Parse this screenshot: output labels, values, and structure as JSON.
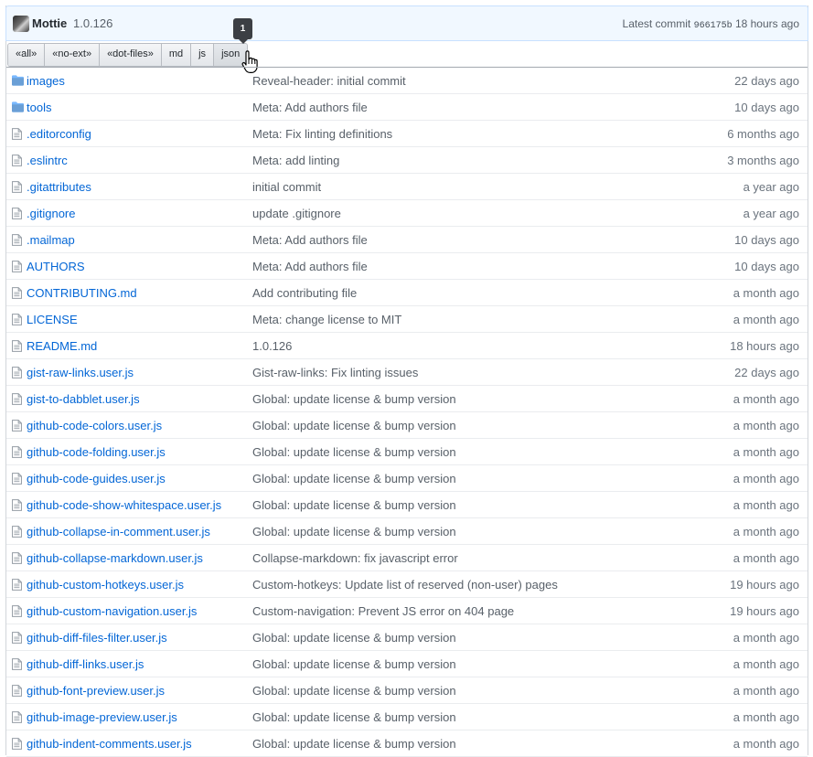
{
  "commit": {
    "author": "Mottie",
    "version": "1.0.126",
    "latest_label": "Latest commit",
    "sha": "966175b",
    "age": "18 hours ago"
  },
  "filters": [
    {
      "label": "«all»"
    },
    {
      "label": "«no-ext»"
    },
    {
      "label": "«dot-files»"
    },
    {
      "label": "md"
    },
    {
      "label": "js"
    },
    {
      "label": "json"
    }
  ],
  "tooltip": {
    "count": "1"
  },
  "files": [
    {
      "type": "folder",
      "name": "images",
      "message": "Reveal-header: initial commit",
      "age": "22 days ago"
    },
    {
      "type": "folder",
      "name": "tools",
      "message": "Meta: Add authors file",
      "age": "10 days ago"
    },
    {
      "type": "file",
      "name": ".editorconfig",
      "message": "Meta: Fix linting definitions",
      "age": "6 months ago"
    },
    {
      "type": "file",
      "name": ".eslintrc",
      "message": "Meta: add linting",
      "age": "3 months ago"
    },
    {
      "type": "file",
      "name": ".gitattributes",
      "message": "initial commit",
      "age": "a year ago"
    },
    {
      "type": "file",
      "name": ".gitignore",
      "message": "update .gitignore",
      "age": "a year ago"
    },
    {
      "type": "file",
      "name": ".mailmap",
      "message": "Meta: Add authors file",
      "age": "10 days ago"
    },
    {
      "type": "file",
      "name": "AUTHORS",
      "message": "Meta: Add authors file",
      "age": "10 days ago"
    },
    {
      "type": "file",
      "name": "CONTRIBUTING.md",
      "message": "Add contributing file",
      "age": "a month ago"
    },
    {
      "type": "file",
      "name": "LICENSE",
      "message": "Meta: change license to MIT",
      "age": "a month ago"
    },
    {
      "type": "file",
      "name": "README.md",
      "message": "1.0.126",
      "age": "18 hours ago"
    },
    {
      "type": "file",
      "name": "gist-raw-links.user.js",
      "message": "Gist-raw-links: Fix linting issues",
      "age": "22 days ago"
    },
    {
      "type": "file",
      "name": "gist-to-dabblet.user.js",
      "message": "Global: update license & bump version",
      "age": "a month ago"
    },
    {
      "type": "file",
      "name": "github-code-colors.user.js",
      "message": "Global: update license & bump version",
      "age": "a month ago"
    },
    {
      "type": "file",
      "name": "github-code-folding.user.js",
      "message": "Global: update license & bump version",
      "age": "a month ago"
    },
    {
      "type": "file",
      "name": "github-code-guides.user.js",
      "message": "Global: update license & bump version",
      "age": "a month ago"
    },
    {
      "type": "file",
      "name": "github-code-show-whitespace.user.js",
      "message": "Global: update license & bump version",
      "age": "a month ago"
    },
    {
      "type": "file",
      "name": "github-collapse-in-comment.user.js",
      "message": "Global: update license & bump version",
      "age": "a month ago"
    },
    {
      "type": "file",
      "name": "github-collapse-markdown.user.js",
      "message": "Collapse-markdown: fix javascript error",
      "age": "a month ago"
    },
    {
      "type": "file",
      "name": "github-custom-hotkeys.user.js",
      "message": "Custom-hotkeys: Update list of reserved (non-user) pages",
      "age": "19 hours ago"
    },
    {
      "type": "file",
      "name": "github-custom-navigation.user.js",
      "message": "Custom-navigation: Prevent JS error on 404 page",
      "age": "19 hours ago"
    },
    {
      "type": "file",
      "name": "github-diff-files-filter.user.js",
      "message": "Global: update license & bump version",
      "age": "a month ago"
    },
    {
      "type": "file",
      "name": "github-diff-links.user.js",
      "message": "Global: update license & bump version",
      "age": "a month ago"
    },
    {
      "type": "file",
      "name": "github-font-preview.user.js",
      "message": "Global: update license & bump version",
      "age": "a month ago"
    },
    {
      "type": "file",
      "name": "github-image-preview.user.js",
      "message": "Global: update license & bump version",
      "age": "a month ago"
    },
    {
      "type": "file",
      "name": "github-indent-comments.user.js",
      "message": "Global: update license & bump version",
      "age": "a month ago"
    }
  ]
}
